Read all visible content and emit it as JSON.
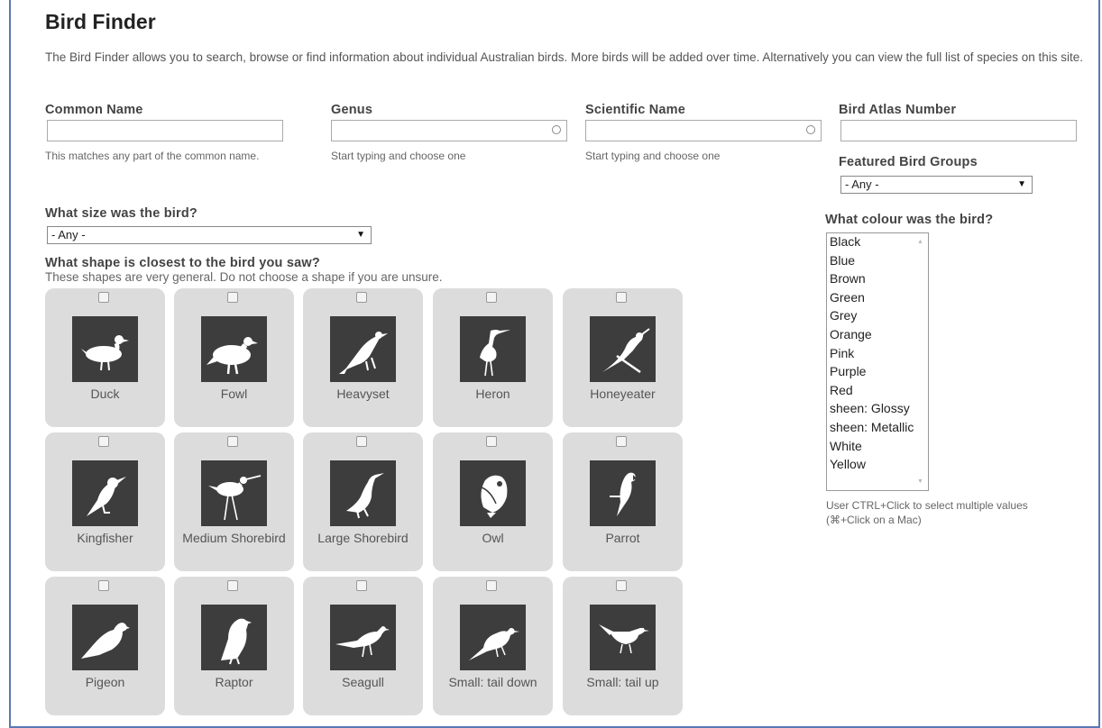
{
  "page": {
    "title": "Bird Finder",
    "intro": "The Bird Finder allows you to search, browse or find information about individual Australian birds. More birds will be added over time. Alternatively you can view the full list of species on this site."
  },
  "fields": {
    "common_name": {
      "label": "Common Name",
      "value": "",
      "help": "This matches any part of the common name."
    },
    "genus": {
      "label": "Genus",
      "value": "",
      "help": "Start typing and choose one"
    },
    "scientific_name": {
      "label": "Scientific Name",
      "value": "",
      "help": "Start typing and choose one"
    },
    "bird_atlas_number": {
      "label": "Bird Atlas Number",
      "value": ""
    },
    "featured_groups": {
      "label": "Featured Bird Groups",
      "selected": "- Any -"
    }
  },
  "size": {
    "label": "What size was the bird?",
    "selected": "- Any -"
  },
  "shape": {
    "label": "What shape is closest to the bird you saw?",
    "sub": "These shapes are very general. Do not choose a shape if you are unsure.",
    "items": [
      {
        "name": "Duck",
        "icon": "duck-icon"
      },
      {
        "name": "Fowl",
        "icon": "fowl-icon"
      },
      {
        "name": "Heavyset",
        "icon": "heavyset-icon"
      },
      {
        "name": "Heron",
        "icon": "heron-icon"
      },
      {
        "name": "Honeyeater",
        "icon": "honeyeater-icon"
      },
      {
        "name": "Kingfisher",
        "icon": "kingfisher-icon"
      },
      {
        "name": "Medium Shorebird",
        "icon": "medium-shorebird-icon"
      },
      {
        "name": "Large Shorebird",
        "icon": "large-shorebird-icon"
      },
      {
        "name": "Owl",
        "icon": "owl-icon"
      },
      {
        "name": "Parrot",
        "icon": "parrot-icon"
      },
      {
        "name": "Pigeon",
        "icon": "pigeon-icon"
      },
      {
        "name": "Raptor",
        "icon": "raptor-icon"
      },
      {
        "name": "Seagull",
        "icon": "seagull-icon"
      },
      {
        "name": "Small: tail down",
        "icon": "small-tail-down-icon"
      },
      {
        "name": "Small: tail up",
        "icon": "small-tail-up-icon"
      }
    ]
  },
  "colour": {
    "label": "What colour was the bird?",
    "options": [
      "Black",
      "Blue",
      "Brown",
      "Green",
      "Grey",
      "Orange",
      "Pink",
      "Purple",
      "Red",
      "sheen: Glossy",
      "sheen: Metallic",
      "White",
      "Yellow"
    ],
    "help_line1": "User CTRL+Click to select multiple values",
    "help_line2": "(⌘+Click on a Mac)"
  },
  "colors": {
    "frame_border": "#5a78b2",
    "tile_bg": "#dcdcdc",
    "icon_bg": "#3d3d3d"
  }
}
